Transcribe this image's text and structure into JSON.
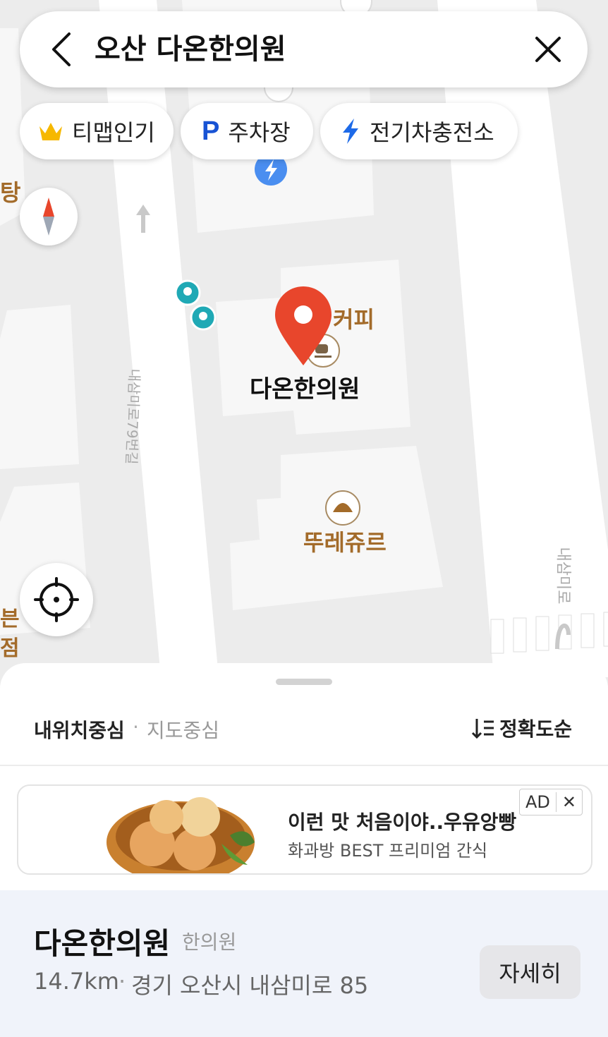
{
  "search": {
    "query": "오산 다온한의원"
  },
  "chips": [
    {
      "label": "티맵인기",
      "icon": "crown-icon"
    },
    {
      "label": "주차장",
      "icon": "parking-icon"
    },
    {
      "label": "전기차충전소",
      "icon": "lightning-icon"
    }
  ],
  "map": {
    "labels": {
      "left_edge_top": "탕",
      "coffee": "커피",
      "selected_place": "다온한의원",
      "bakery": "뚜레쥬르",
      "road_1": "내삼미로79번길",
      "road_2": "내삼미로",
      "left_edge_bottom_1": "븐",
      "left_edge_bottom_2": "점"
    },
    "colors": {
      "marker": "#e8462c",
      "poi_text": "#a36b2a",
      "ev": "#4a8ef0",
      "teal": "#1fa9b5"
    }
  },
  "sheet": {
    "filter": {
      "my_location": "내위치중심",
      "separator": "·",
      "map_center": "지도중심",
      "sort": "정확도순"
    },
    "ad": {
      "headline": "이런 맛 처음이야..우유앙빵",
      "subline": "화과방 BEST 프리미엄 간식",
      "badge": "AD",
      "close": "✕"
    },
    "result": {
      "name": "다온한의원",
      "category": "한의원",
      "distance": "14.7km",
      "separator": "·",
      "address": "경기 오산시 내삼미로 85",
      "detail_button": "자세히"
    }
  }
}
